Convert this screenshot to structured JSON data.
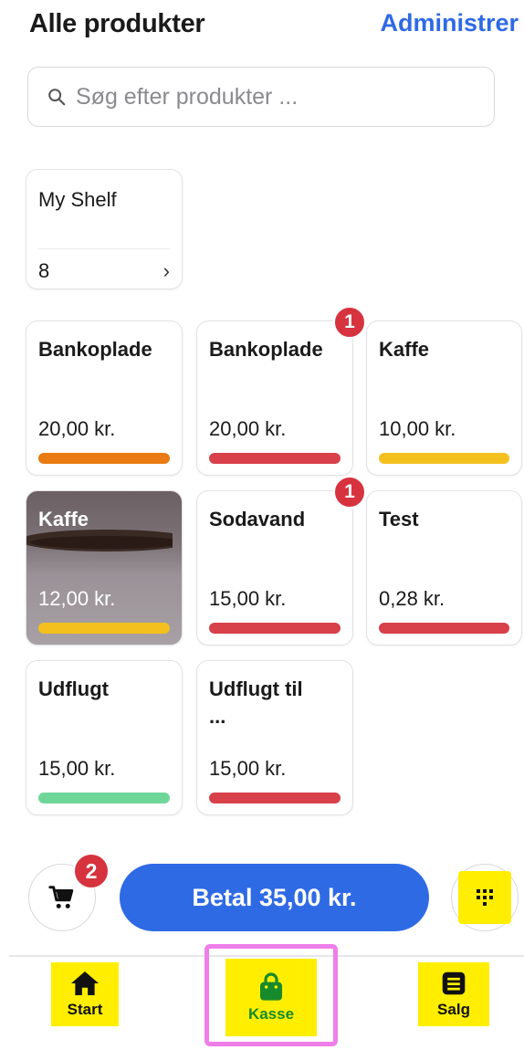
{
  "header": {
    "title": "Alle produkter",
    "manage_label": "Administrer"
  },
  "search": {
    "placeholder": "Søg efter produkter ...",
    "value": ""
  },
  "shelf": {
    "name": "My Shelf",
    "count": "8",
    "chevron": "›"
  },
  "products": [
    {
      "name": "Bankoplade",
      "price": "20,00 kr.",
      "bar_color": "#ea7a12",
      "badge": ""
    },
    {
      "name": "Bankoplade",
      "price": "20,00 kr.",
      "bar_color": "#d8404a",
      "badge": "1"
    },
    {
      "name": "Kaffe",
      "price": "10,00 kr.",
      "bar_color": "#f4c01e",
      "badge": ""
    },
    {
      "name": "Kaffe",
      "price": "12,00 kr.",
      "bar_color": "#f4c01e",
      "badge": "",
      "photo": true
    },
    {
      "name": "Sodavand",
      "price": "15,00 kr.",
      "bar_color": "#d8404a",
      "badge": "1"
    },
    {
      "name": "Test",
      "price": "0,28 kr.",
      "bar_color": "#d8404a",
      "badge": ""
    },
    {
      "name": "Udflugt",
      "price": "15,00 kr.",
      "bar_color": "#6fd69a",
      "badge": ""
    },
    {
      "name": "Udflugt til ...",
      "price": "15,00 kr.",
      "bar_color": "#d8404a",
      "badge": ""
    }
  ],
  "cart": {
    "badge": "2",
    "icon": "cart-icon"
  },
  "pay": {
    "label": "Betal 35,00 kr."
  },
  "keypad": {
    "icon": "keypad-icon"
  },
  "tabs": [
    {
      "label": "Start",
      "icon": "home-icon"
    },
    {
      "label": "Kasse",
      "icon": "shopping-bag-icon"
    },
    {
      "label": "Salg",
      "icon": "receipt-list-icon"
    }
  ],
  "colors": {
    "accent": "#2f6ae5",
    "badge": "#d6333f",
    "highlight": "#ffee00",
    "selection_frame": "#ef7ee9"
  }
}
